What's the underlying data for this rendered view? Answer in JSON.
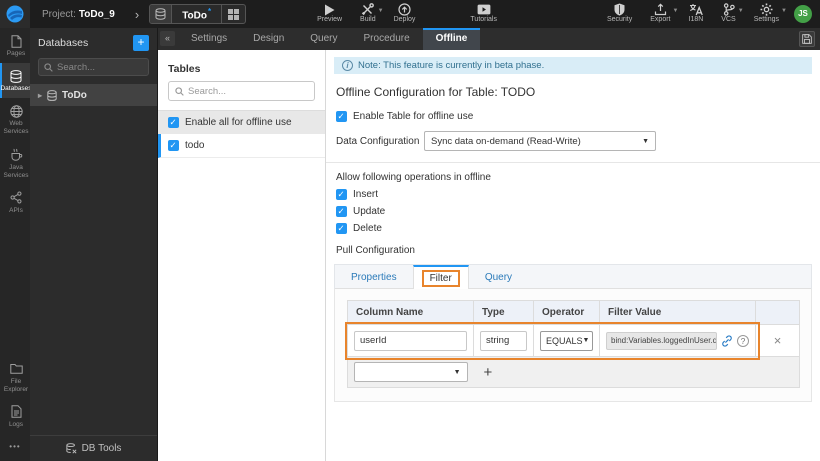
{
  "colors": {
    "accent": "#2196f3",
    "annotation_orange": "#e8842c",
    "note_bg": "#d9edf7",
    "avatar_bg": "#43a047"
  },
  "topbar": {
    "project_label": "Project:",
    "project_name": "ToDo_9",
    "artifact": {
      "name": "ToDo",
      "dirty_mark": "*"
    },
    "actions": {
      "preview": "Preview",
      "build": "Build",
      "deploy": "Deploy",
      "tutorials": "Tutorials",
      "security": "Security",
      "export": "Export",
      "i18n": "I18N",
      "vcs": "VCS",
      "settings": "Settings"
    },
    "avatar_initials": "JS"
  },
  "rail": {
    "pages": "Pages",
    "databases": "Databases",
    "web_services": "Web Services",
    "java_services": "Java Services",
    "apis": "APIs",
    "file_explorer": "File Explorer",
    "logs": "Logs",
    "more": "•••"
  },
  "db_panel": {
    "title": "Databases",
    "add_button": "+",
    "search_placeholder": "Search...",
    "expand_arrow": "▸",
    "item_todo": "ToDo",
    "footer": "DB Tools"
  },
  "ws_tabs": {
    "collapse": "«",
    "settings": "Settings",
    "design": "Design",
    "query": "Query",
    "procedure": "Procedure",
    "offline": "Offline"
  },
  "tables_panel": {
    "title": "Tables",
    "search_placeholder": "Search...",
    "enable_all_label": "Enable all for offline use",
    "table_todo": "todo"
  },
  "main": {
    "note": "Note: This feature is currently in beta phase.",
    "heading": "Offline Configuration for Table: TODO",
    "enable_table_label": "Enable Table for offline use",
    "data_config_label": "Data Configuration",
    "data_config_value": "Sync data on-demand (Read-Write)",
    "operations_label": "Allow following operations in offline",
    "operations": [
      "Insert",
      "Update",
      "Delete"
    ],
    "pull_config_label": "Pull Configuration",
    "pull_tabs": {
      "properties": "Properties",
      "filter": "Filter",
      "query": "Query"
    },
    "filter_table": {
      "headers": [
        "Column Name",
        "Type",
        "Operator",
        "Filter Value"
      ],
      "row": {
        "column_name": "userId",
        "type": "string",
        "operator": "EQUALS",
        "filter_value_chip": "bind:Variables.loggedInUser.data",
        "chip_remove": "×",
        "delete": "×"
      },
      "add_button": "+"
    }
  }
}
